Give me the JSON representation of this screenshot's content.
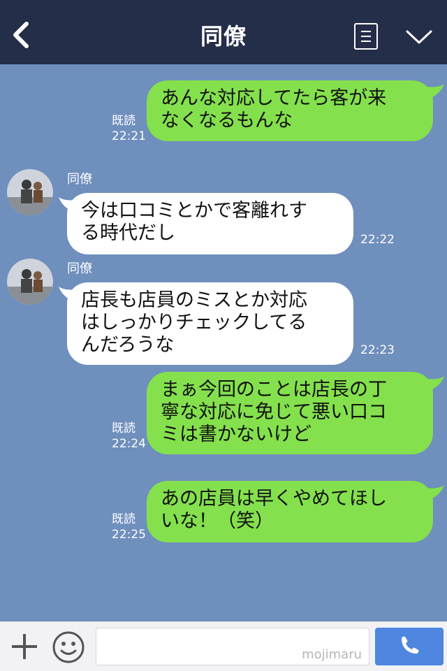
{
  "header": {
    "title": "同僚"
  },
  "messages": [
    {
      "side": "out",
      "read": "既読",
      "time": "22:21",
      "lines": [
        "あんな対応してたら客が来",
        "なくなるもんな"
      ]
    },
    {
      "side": "in",
      "sender": "同僚",
      "time": "22:22",
      "lines": [
        "今は口コミとかで客離れす",
        "る時代だし"
      ]
    },
    {
      "side": "in",
      "sender": "同僚",
      "time": "22:23",
      "lines": [
        "店長も店員のミスとか対応",
        "はしっかりチェックしてる",
        "んだろうな"
      ]
    },
    {
      "side": "out",
      "read": "既読",
      "time": "22:24",
      "lines": [
        "まぁ今回のことは店長の丁",
        "寧な対応に免じて悪い口コ",
        "ミは書かないけど"
      ]
    },
    {
      "side": "out",
      "read": "既読",
      "time": "22:25",
      "lines": [
        "あの店員は早くやめてほし",
        "いな！（笑）"
      ]
    }
  ],
  "footer": {
    "watermark": "mojimaru"
  },
  "colors": {
    "header": "#242e48",
    "chat_bg": "#6f8fbd",
    "outgoing": "#84e04d",
    "incoming": "#ffffff",
    "call_button": "#4e86e0"
  },
  "icons": {
    "back": "chevron-left-icon",
    "menu": "menu-icon",
    "collapse": "chevron-down-icon",
    "add": "plus-icon",
    "sticker": "smile-icon",
    "call": "phone-icon"
  }
}
